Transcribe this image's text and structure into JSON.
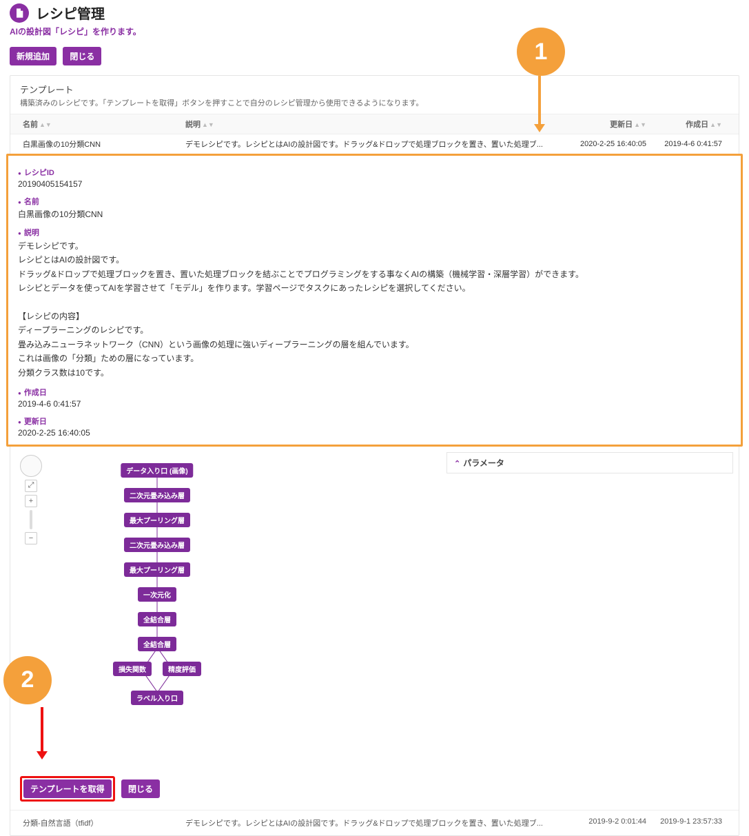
{
  "header": {
    "title": "レシピ管理",
    "subtitle": "AIの設計図「レシピ」を作ります。"
  },
  "buttons": {
    "add": "新規追加",
    "close": "閉じる",
    "get_template": "テンプレートを取得",
    "close2": "閉じる"
  },
  "template_panel": {
    "title": "テンプレート",
    "desc": "構築済みのレシピです。「テンプレートを取得」ボタンを押すことで自分のレシピ管理から使用できるようになります。"
  },
  "columns": {
    "name": "名前",
    "desc": "説明",
    "updated": "更新日",
    "created": "作成日"
  },
  "row1": {
    "name": "白黒画像の10分類CNN",
    "desc": "デモレシピです。レシピとはAIの設計図です。ドラッグ&ドロップで処理ブロックを置き、置いた処理ブ...",
    "updated": "2020-2-25 16:40:05",
    "created": "2019-4-6 0:41:57"
  },
  "detail": {
    "labels": {
      "recipe_id": "レシピID",
      "name": "名前",
      "desc": "説明",
      "created": "作成日",
      "updated": "更新日"
    },
    "recipe_id": "20190405154157",
    "name": "白黒画像の10分類CNN",
    "desc": "デモレシピです。\nレシピとはAIの設計図です。\nドラッグ&ドロップで処理ブロックを置き、置いた処理ブロックを結ぶことでプログラミングをする事なくAIの構築（機械学習・深層学習）ができます。\nレシピとデータを使ってAIを学習させて「モデル」を作ります。学習ページでタスクにあったレシピを選択してください。\n\n【レシピの内容】\nディープラーニングのレシピです。\n畳み込みニューラネットワーク（CNN）という画像の処理に強いディープラーニングの層を組んでいます。\nこれは画像の「分類」ための層になっています。\n分類クラス数は10です。",
    "created": "2019-4-6 0:41:57",
    "updated": "2020-2-25 16:40:05"
  },
  "param_header": "パラメータ",
  "nodes": {
    "n0": "データ入り口 (画像)",
    "n1": "二次元畳み込み層",
    "n2": "最大プーリング層",
    "n3": "二次元畳み込み層",
    "n4": "最大プーリング層",
    "n5": "一次元化",
    "n6": "全結合層",
    "n7": "全結合層",
    "n8a": "損失関数",
    "n8b": "精度評価",
    "n9": "ラベル入り口"
  },
  "callouts": {
    "c1": "1",
    "c2": "2"
  },
  "row2": {
    "name": "分類-自然言語（tfidf）",
    "desc": "デモレシピです。レシピとはAIの設計図です。ドラッグ&ドロップで処理ブロックを置き、置いた処理ブ...",
    "updated": "2019-9-2 0:01:44",
    "created": "2019-9-1 23:57:33"
  }
}
